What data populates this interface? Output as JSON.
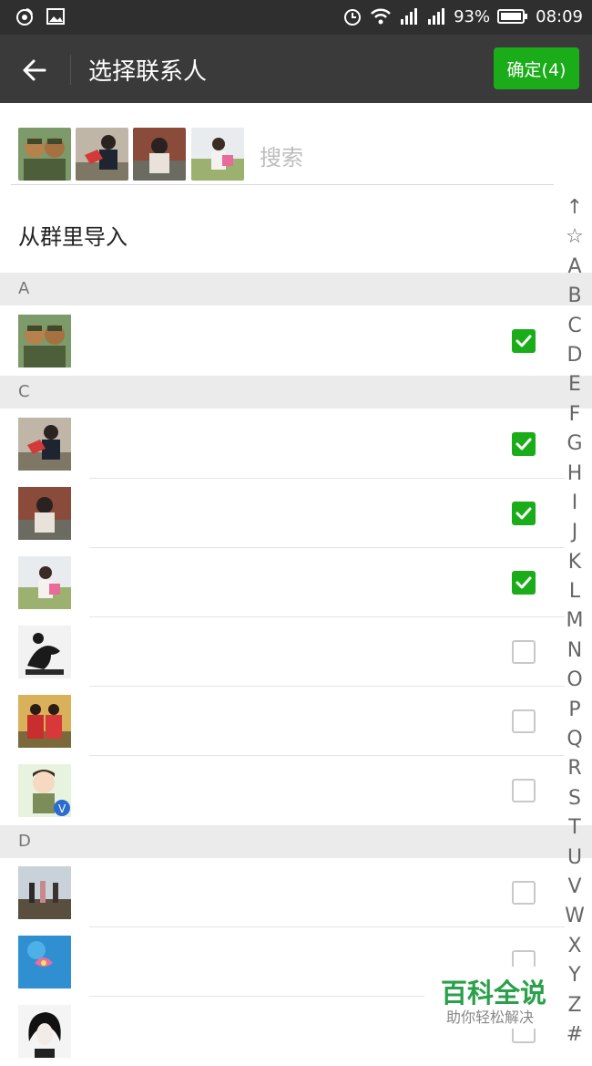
{
  "statusbar": {
    "battery": "93%",
    "time": "08:09",
    "icons": [
      "weibo-icon",
      "image-icon",
      "alarm-icon",
      "wifi-icon",
      "signal-icon",
      "signal-icon",
      "battery-icon"
    ]
  },
  "header": {
    "title": "选择联系人",
    "confirm_label": "确定(4)"
  },
  "search": {
    "placeholder": "搜索"
  },
  "import_label": "从群里导入",
  "sections": [
    {
      "letter": "A"
    },
    {
      "letter": "C"
    },
    {
      "letter": "D"
    }
  ],
  "contacts": [
    {
      "section": "A",
      "checked": true
    },
    {
      "section": "C",
      "checked": true
    },
    {
      "section": "C",
      "checked": true
    },
    {
      "section": "C",
      "checked": true
    },
    {
      "section": "C",
      "checked": false
    },
    {
      "section": "C",
      "checked": false
    },
    {
      "section": "C",
      "checked": false
    },
    {
      "section": "D",
      "checked": false
    },
    {
      "section": "D",
      "checked": false
    },
    {
      "section": "D",
      "checked": false
    }
  ],
  "index_letters": [
    "↑",
    "☆",
    "A",
    "B",
    "C",
    "D",
    "E",
    "F",
    "G",
    "H",
    "I",
    "J",
    "K",
    "L",
    "M",
    "N",
    "O",
    "P",
    "Q",
    "R",
    "S",
    "T",
    "U",
    "V",
    "W",
    "X",
    "Y",
    "Z",
    "#"
  ],
  "watermark": {
    "title": "百科全说",
    "subtitle": "助你轻松解决"
  },
  "colors": {
    "accent": "#1aad19",
    "header_bg": "#3a3a3a",
    "statusbar_bg": "#2f2f2f",
    "section_bg": "#ebebeb"
  }
}
